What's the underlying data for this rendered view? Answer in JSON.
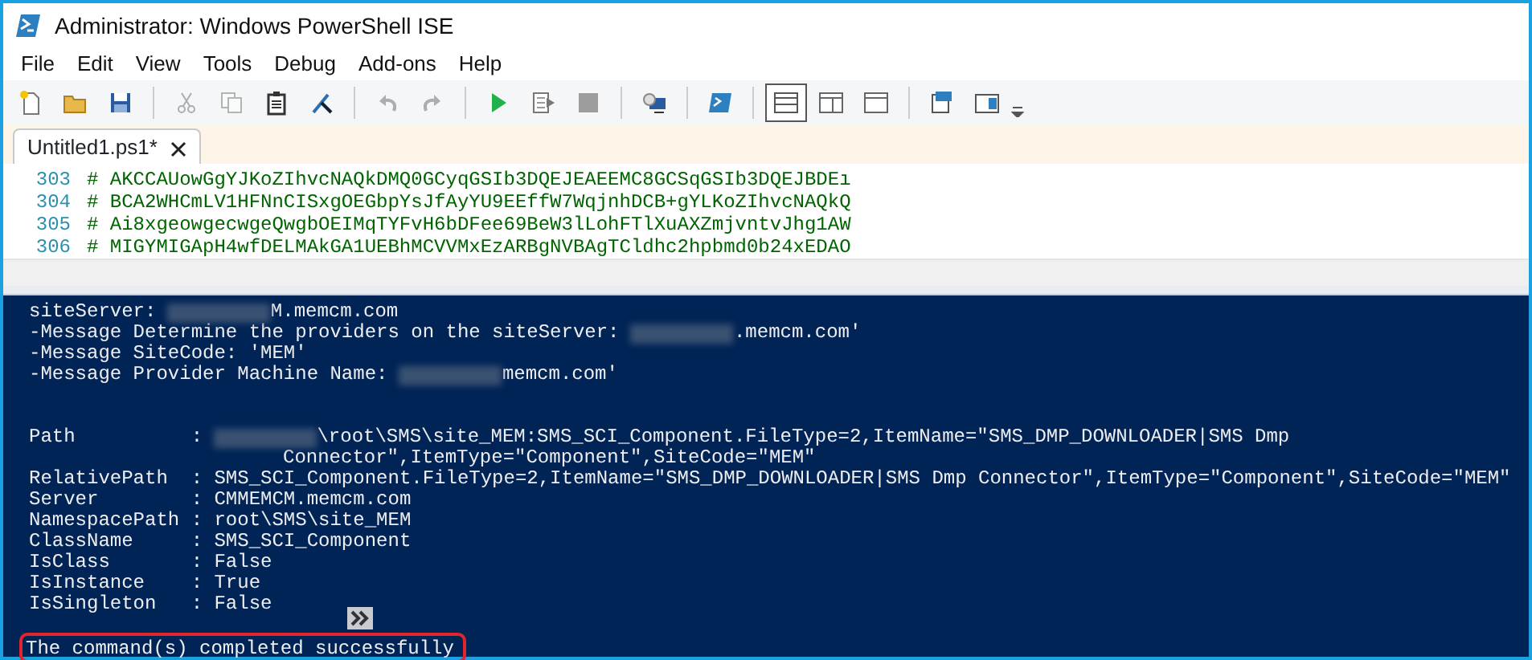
{
  "window": {
    "title": "Administrator: Windows PowerShell ISE"
  },
  "menu": [
    "File",
    "Edit",
    "View",
    "Tools",
    "Debug",
    "Add-ons",
    "Help"
  ],
  "toolbar": [
    {
      "disabled": false,
      "selected": false
    },
    {
      "disabled": false,
      "selected": false
    },
    {
      "disabled": false,
      "selected": false
    },
    {
      "disabled": true,
      "selected": false
    },
    {
      "disabled": true,
      "selected": false
    },
    {
      "disabled": false,
      "selected": false
    },
    {
      "disabled": false,
      "selected": false
    },
    {
      "disabled": true,
      "selected": false
    },
    {
      "disabled": true,
      "selected": false
    },
    {
      "disabled": false,
      "selected": false
    },
    {
      "disabled": false,
      "selected": false
    },
    {
      "disabled": true,
      "selected": false
    },
    {
      "disabled": false,
      "selected": false
    },
    {
      "disabled": false,
      "selected": false
    },
    {
      "disabled": false,
      "selected": true
    },
    {
      "disabled": false,
      "selected": false
    },
    {
      "disabled": false,
      "selected": false
    },
    {
      "disabled": false,
      "selected": false
    },
    {
      "disabled": false,
      "selected": false
    }
  ],
  "tabs": [
    {
      "label": "Untitled1.ps1*",
      "selected": true
    }
  ],
  "editor": {
    "lines": [
      {
        "number": "303",
        "text": "# AKCCAUowGgYJKoZIhvcNAQkDMQ0GCyqGSIb3DQEJEAEEMC8GCSqGSIb3DQEJBDEı"
      },
      {
        "number": "304",
        "text": "# BCA2WHCmLV1HFNnCISxgOEGbpYsJfAyYU9EEffW7WqjnhDCB+gYLKoZIhvcNAQkQ"
      },
      {
        "number": "305",
        "text": "# Ai8xgeowgecwgeQwgbOEIMqTYFvH6bDFee69BeW3lLohFTlXuAXZmjvntvJhg1AW"
      },
      {
        "number": "306",
        "text": "# MIGYMIGApH4wfDELMAkGA1UEBhMCVVMxEzARBgNVBAgTCldhc2hpbmd0b24xEDAO"
      }
    ]
  },
  "console": {
    "lines": [
      [
        {
          "kind": "text",
          "text": "siteServer: "
        },
        {
          "kind": "redacted"
        },
        {
          "kind": "text",
          "text": "M.memcm.com"
        }
      ],
      [
        {
          "kind": "text",
          "text": "-Message Determine the providers on the siteServer: "
        },
        {
          "kind": "redacted"
        },
        {
          "kind": "text",
          "text": ".memcm.com'"
        }
      ],
      [
        {
          "kind": "text",
          "text": "-Message SiteCode: 'MEM'"
        }
      ],
      [
        {
          "kind": "text",
          "text": "-Message Provider Machine Name: "
        },
        {
          "kind": "redacted"
        },
        {
          "kind": "text",
          "text": "memcm.com'"
        }
      ],
      {
        "kind": "blank"
      },
      {
        "kind": "blank"
      },
      [
        {
          "kind": "text",
          "text": "Path          : "
        },
        {
          "kind": "redacted"
        },
        {
          "kind": "text",
          "text": "\\root\\SMS\\site_MEM:SMS_SCI_Component.FileType=2,ItemName=\"SMS_DMP_DOWNLOADER|SMS Dmp"
        }
      ],
      [
        {
          "kind": "indent"
        },
        {
          "kind": "text",
          "text": "Connector\",ItemType=\"Component\",SiteCode=\"MEM\""
        }
      ],
      [
        {
          "kind": "text",
          "text": "RelativePath  : SMS_SCI_Component.FileType=2,ItemName=\"SMS_DMP_DOWNLOADER|SMS Dmp Connector\",ItemType=\"Component\",SiteCode=\"MEM\""
        }
      ],
      [
        {
          "kind": "text",
          "text": "Server        : CMMEMCM.memcm.com"
        }
      ],
      [
        {
          "kind": "text",
          "text": "NamespacePath : root\\SMS\\site_MEM"
        }
      ],
      [
        {
          "kind": "text",
          "text": "ClassName     : SMS_SCI_Component"
        }
      ],
      [
        {
          "kind": "text",
          "text": "IsClass       : False"
        }
      ],
      [
        {
          "kind": "text",
          "text": "IsInstance    : True"
        }
      ],
      [
        {
          "kind": "text",
          "text": "IsSingleton   : False"
        }
      ],
      {
        "kind": "blank"
      },
      [
        {
          "kind": "highlight",
          "text": "The command(s) completed successfully"
        }
      ]
    ]
  }
}
